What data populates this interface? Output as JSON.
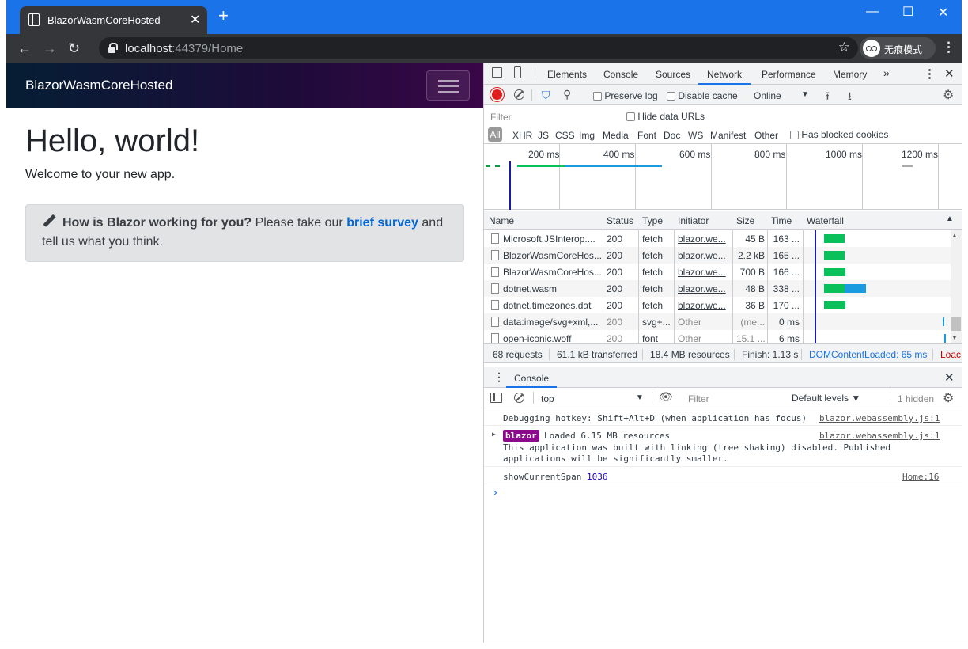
{
  "browser": {
    "tab_title": "BlazorWasmCoreHosted",
    "url_host": "localhost",
    "url_rest": ":44379/Home",
    "profile_label": "无痕模式",
    "accent": "#1a73e8"
  },
  "page": {
    "brand": "BlazorWasmCoreHosted",
    "heading": "Hello, world!",
    "welcome": "Welcome to your new app.",
    "survey_question": "How is Blazor working for you?",
    "survey_text_1": "Please take our",
    "survey_link": "brief survey",
    "survey_text_2": "and tell us what you think."
  },
  "devtools": {
    "tabs": [
      "Elements",
      "Console",
      "Sources",
      "Network",
      "Performance",
      "Memory"
    ],
    "more": "»",
    "preserve_log": "Preserve log",
    "disable_cache": "Disable cache",
    "throttle": "Online",
    "filter_placeholder": "Filter",
    "hide_data_urls": "Hide data URLs",
    "types": [
      "All",
      "XHR",
      "JS",
      "CSS",
      "Img",
      "Media",
      "Font",
      "Doc",
      "WS",
      "Manifest",
      "Other"
    ],
    "has_blocked": "Has blocked cookies",
    "timeline_ticks": [
      "200 ms",
      "400 ms",
      "600 ms",
      "800 ms",
      "1000 ms",
      "1200 ms"
    ],
    "columns": [
      "Name",
      "Status",
      "Type",
      "Initiator",
      "Size",
      "Time",
      "Waterfall"
    ],
    "rows": [
      {
        "name": "Microsoft.JSInterop....",
        "status": "200",
        "type": "fetch",
        "initiator": "blazor.we...",
        "size": "45 B",
        "time": "163 ..."
      },
      {
        "name": "BlazorWasmCoreHos...",
        "status": "200",
        "type": "fetch",
        "initiator": "blazor.we...",
        "size": "2.2 kB",
        "time": "165 ..."
      },
      {
        "name": "BlazorWasmCoreHos...",
        "status": "200",
        "type": "fetch",
        "initiator": "blazor.we...",
        "size": "700 B",
        "time": "166 ..."
      },
      {
        "name": "dotnet.wasm",
        "status": "200",
        "type": "fetch",
        "initiator": "blazor.we...",
        "size": "48 B",
        "time": "338 ..."
      },
      {
        "name": "dotnet.timezones.dat",
        "status": "200",
        "type": "fetch",
        "initiator": "blazor.we...",
        "size": "36 B",
        "time": "170 ..."
      },
      {
        "name": "data:image/svg+xml,...",
        "status": "200",
        "type": "svg+...",
        "initiator": "Other",
        "size": "(me...",
        "time": "0 ms"
      },
      {
        "name": "open-iconic.woff",
        "status": "200",
        "type": "font",
        "initiator": "Other",
        "size": "15.1 ...",
        "time": "6 ms"
      }
    ],
    "summary": {
      "requests": "68 requests",
      "transferred": "61.1 kB transferred",
      "resources": "18.4 MB resources",
      "finish": "Finish: 1.13 s",
      "dcl": "DOMContentLoaded: 65 ms",
      "load": "Loac"
    },
    "console_tab": "Console",
    "context": "top",
    "console_filter_placeholder": "Filter",
    "levels": "Default levels ▼",
    "hidden": "1 hidden",
    "messages": [
      {
        "text": "Debugging hotkey: Shift+Alt+D (when application has focus)",
        "source": "blazor.webassembly.js:1"
      },
      {
        "badge": "blazor",
        "text": "Loaded 6.15 MB resources",
        "detail1": "This application was built with linking (tree shaking) disabled. Published",
        "detail2": "applications will be significantly smaller.",
        "source": "blazor.webassembly.js:1"
      },
      {
        "text": "showCurrentSpan",
        "value": "1036",
        "source": "Home:16"
      }
    ],
    "prompt": "›"
  }
}
